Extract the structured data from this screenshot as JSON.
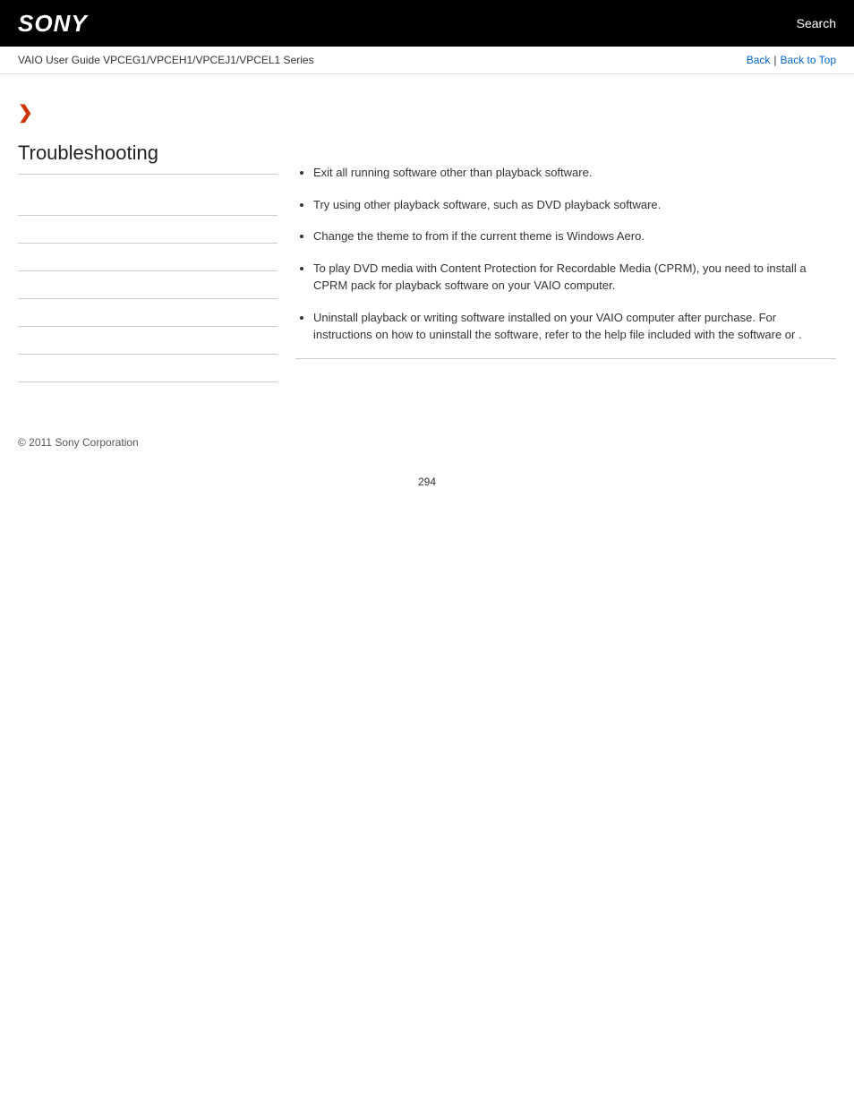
{
  "header": {
    "logo": "SONY",
    "search_label": "Search"
  },
  "breadcrumb": {
    "guide_text": "VAIO User Guide VPCEG1/VPCEH1/VPCEJ1/VPCEL1 Series",
    "back_label": "Back",
    "separator": "|",
    "back_to_top_label": "Back to Top"
  },
  "sidebar": {
    "chevron": "❯",
    "title": "Troubleshooting",
    "nav_items": [
      {
        "label": ""
      },
      {
        "label": ""
      },
      {
        "label": ""
      },
      {
        "label": ""
      },
      {
        "label": ""
      },
      {
        "label": ""
      },
      {
        "label": ""
      }
    ]
  },
  "content": {
    "bullet_1": "Exit all running software other than playback software.",
    "bullet_2": "Try using other playback software, such as DVD playback software.",
    "bullet_3": "Change the theme to                                from                                if the current theme is Windows Aero.",
    "bullet_4": "To play DVD media with Content Protection for Recordable Media (CPRM), you need to install a CPRM pack for playback software on your VAIO computer.",
    "bullet_5": "Uninstall playback or writing software installed on your VAIO computer after purchase. For instructions on how to uninstall the software, refer to the help file included with the software or                              ."
  },
  "footer": {
    "copyright": "© 2011 Sony Corporation"
  },
  "page_number": "294"
}
